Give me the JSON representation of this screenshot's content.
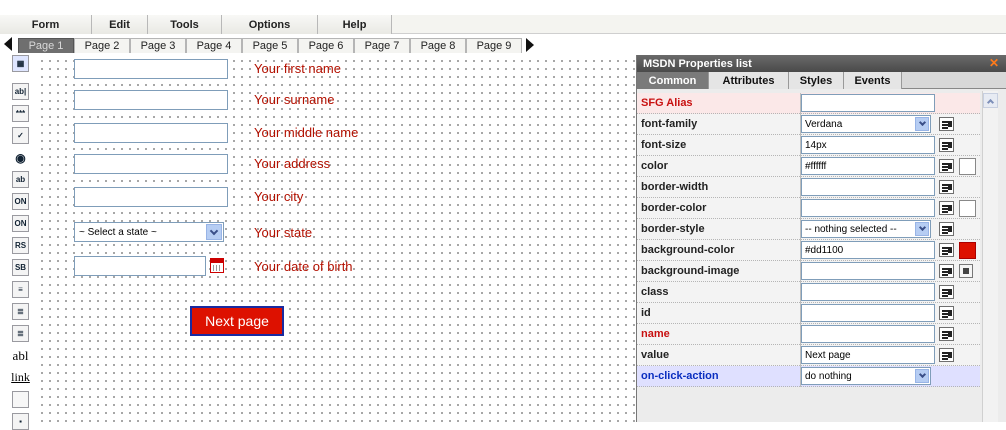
{
  "menu": [
    "Form",
    "Edit",
    "Tools",
    "Options",
    "Help"
  ],
  "pages": [
    "Page 1",
    "Page 2",
    "Page 3",
    "Page 4",
    "Page 5",
    "Page 6",
    "Page 7",
    "Page 8",
    "Page 9"
  ],
  "active_page": "Page 1",
  "toolbar_icons": [
    "form-properties-icon",
    "text-field-icon",
    "password-field-icon",
    "checkbox-icon",
    "radio-icon",
    "textarea-icon",
    "option1-icon",
    "option2-icon",
    "radio-select-icon",
    "select-icon",
    "multi-select-icon",
    "list-icon",
    "list2-icon",
    "label-icon",
    "link-icon",
    "button-icon",
    "image-icon"
  ],
  "toolbar_text": {
    "label": "abl",
    "link": "link"
  },
  "form": {
    "fields": [
      {
        "label": "Your first name"
      },
      {
        "label": "Your surname"
      },
      {
        "label": "Your middle name"
      },
      {
        "label": "Your address"
      },
      {
        "label": "Your city"
      },
      {
        "label": "Your state",
        "select_value": "~ Select a state ~"
      },
      {
        "label": "Your date of birth"
      }
    ],
    "button_label": "Next page",
    "label_color": "#b31000",
    "button_color": "#dd1100"
  },
  "panel": {
    "title": "MSDN Properties list",
    "tabs": [
      "Common",
      "Attributes",
      "Styles",
      "Events"
    ],
    "active_tab": "Common",
    "rows": [
      {
        "name": "SFG Alias",
        "value": ""
      },
      {
        "name": "font-family",
        "value": "Verdana"
      },
      {
        "name": "font-size",
        "value": "14px"
      },
      {
        "name": "color",
        "value": "#ffffff"
      },
      {
        "name": "border-width",
        "value": ""
      },
      {
        "name": "border-color",
        "value": ""
      },
      {
        "name": "border-style",
        "value": "-- nothing selected --"
      },
      {
        "name": "background-color",
        "value": "#dd1100"
      },
      {
        "name": "background-image",
        "value": ""
      },
      {
        "name": "class",
        "value": ""
      },
      {
        "name": "id",
        "value": ""
      },
      {
        "name": "name",
        "value": ""
      },
      {
        "name": "value",
        "value": "Next page"
      },
      {
        "name": "on-click-action",
        "value": "do nothing"
      }
    ],
    "swatches": {
      "color": "#ffffff",
      "border-color": "#ffffff",
      "background-color": "#dd1100"
    }
  }
}
